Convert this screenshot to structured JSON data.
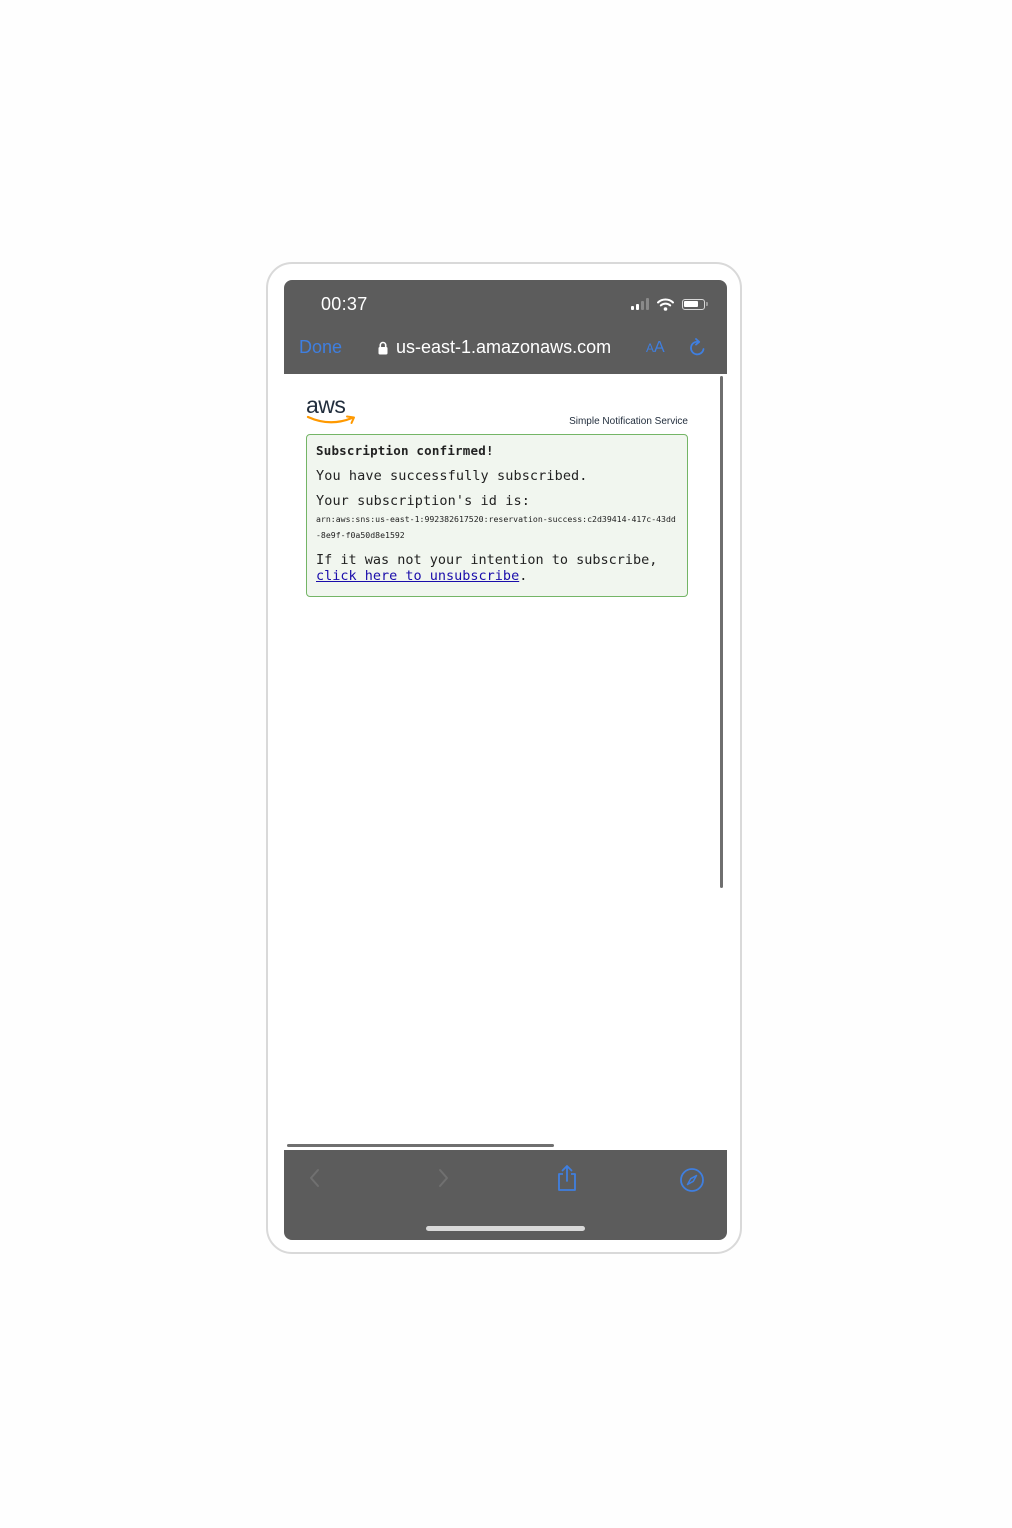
{
  "status_bar": {
    "time": "00:37",
    "icons": [
      "cellular-signal-icon",
      "wifi-icon",
      "battery-icon"
    ]
  },
  "browser_nav": {
    "done_label": "Done",
    "url": "us-east-1.amazonaws.com",
    "text_size_small": "A",
    "text_size_big": "A",
    "icons": [
      "lock-icon",
      "reload-icon"
    ]
  },
  "page": {
    "logo_text": "aws",
    "service_name": "Simple Notification Service",
    "heading": "Subscription confirmed!",
    "success_message": "You have successfully subscribed.",
    "id_label": "Your subscription's id is:",
    "subscription_arn": "arn:aws:sns:us-east-1:992382617520:reservation-success:c2d39414-417c-43dd-8e9f-f0a50d8e1592",
    "unsubscribe_prefix": "If it was not your intention to subscribe, ",
    "unsubscribe_link": "click here to unsubscribe",
    "unsubscribe_suffix": "."
  },
  "toolbar": {
    "icons": [
      "back-icon",
      "forward-icon",
      "share-icon",
      "safari-compass-icon"
    ]
  },
  "colors": {
    "accent_blue": "#3f7fe0",
    "chrome_gray": "#5c5c5c",
    "box_border": "#74b566",
    "box_background": "#f1f6ef",
    "link": "#1a0dab",
    "aws_orange": "#ff9900"
  }
}
